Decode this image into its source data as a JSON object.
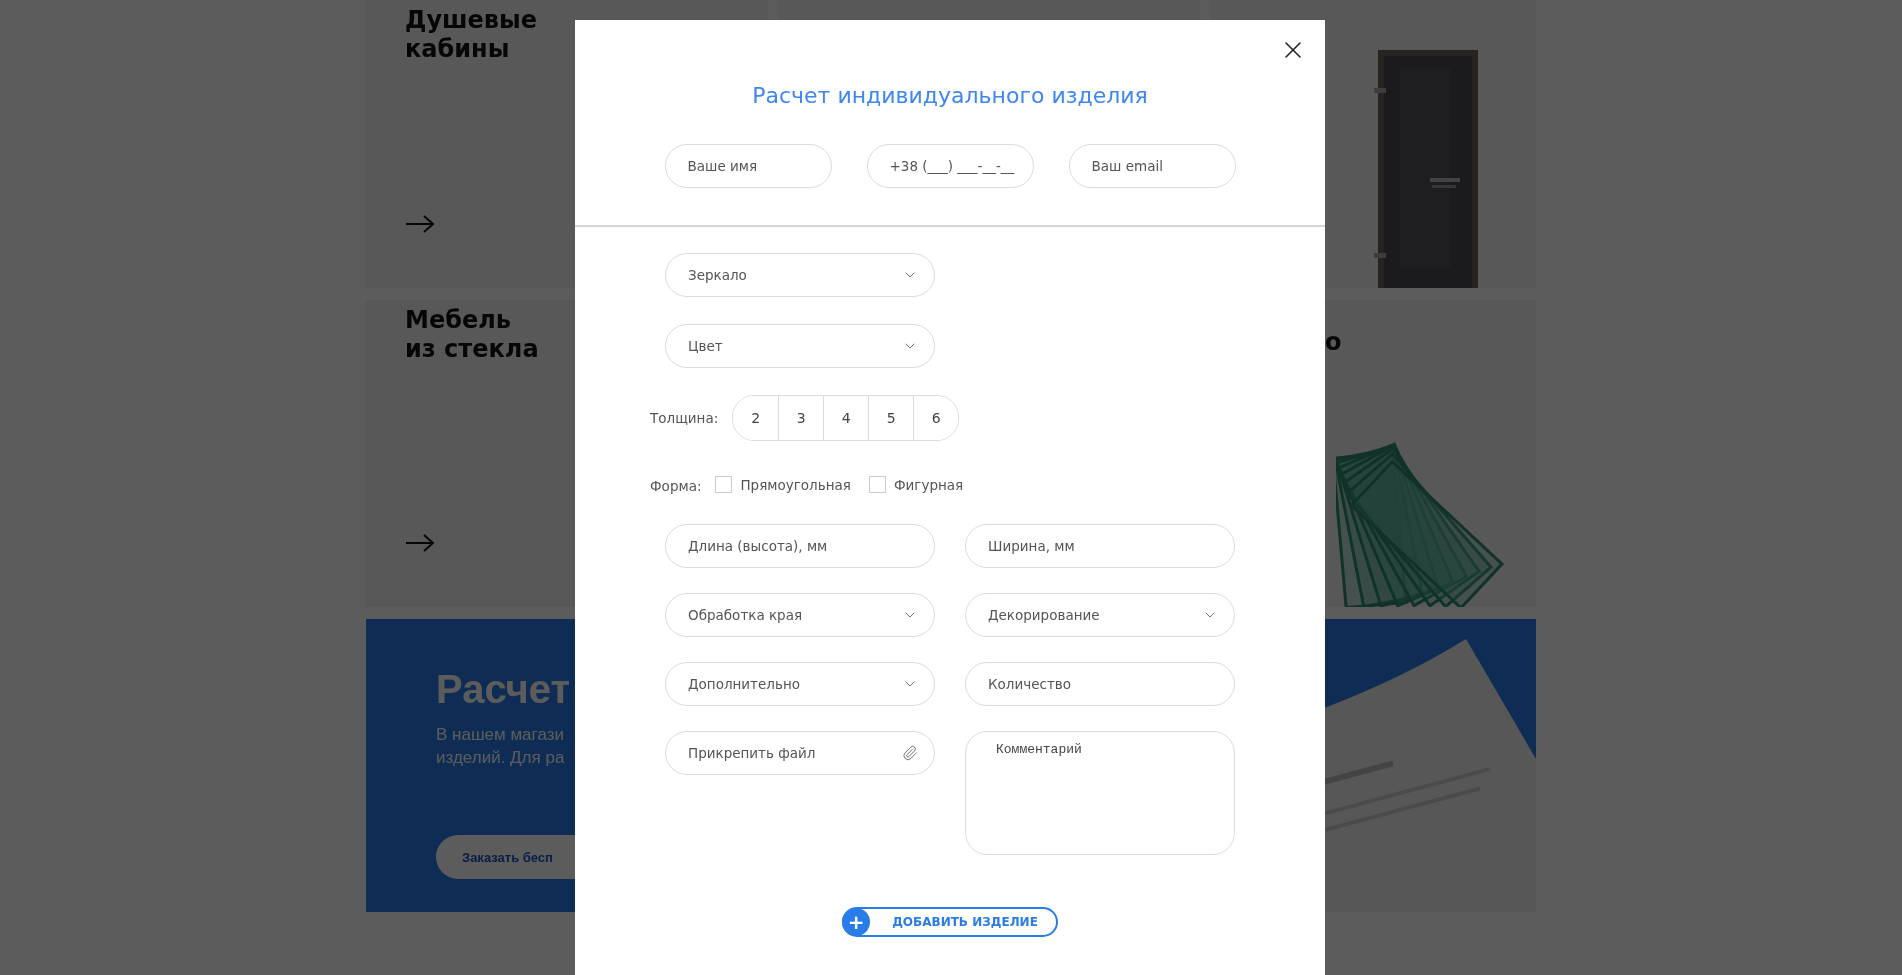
{
  "background": {
    "card_rows": [
      [
        {
          "title": "Душевые\nкабины",
          "kind": "arrow"
        },
        {
          "kind": "plain"
        },
        {
          "kind": "door"
        }
      ],
      [
        {
          "title": "Мебель\nиз стекла",
          "kind": "arrow"
        },
        null,
        {
          "title": "о",
          "kind": "glass"
        }
      ]
    ],
    "banner": {
      "title": "Расчет",
      "text": "В нашем магази\nизделий. Для ра",
      "button": "Заказать бесп"
    }
  },
  "modal": {
    "title": "Расчет индивидуального изделия",
    "contacts": [
      {
        "placeholder": "Ваше имя"
      },
      {
        "placeholder": "+38 (___) ___-__-__"
      },
      {
        "placeholder": "Ваш email"
      }
    ],
    "selects": [
      {
        "value": "Зеркало"
      },
      {
        "value": "Цвет"
      }
    ],
    "thickness": {
      "label": "Толщина:",
      "options": [
        {
          "label": "2",
          "selected": false
        },
        {
          "label": "3",
          "selected": false
        },
        {
          "label": "4",
          "selected": false
        },
        {
          "label": "5",
          "selected": false
        },
        {
          "label": "6",
          "selected": false
        }
      ]
    },
    "shape": {
      "label": "Форма:",
      "options": [
        {
          "label": "Прямоугольная",
          "checked": false
        },
        {
          "label": "Фигурная",
          "checked": false
        }
      ]
    },
    "fields": [
      {
        "kind": "input",
        "placeholder": "Длина (высота), мм"
      },
      {
        "kind": "input",
        "placeholder": "Ширина, мм"
      },
      {
        "kind": "select",
        "placeholder": "Обработка края"
      },
      {
        "kind": "select",
        "placeholder": "Декорирование"
      },
      {
        "kind": "select",
        "placeholder": "Дополнительно"
      },
      {
        "kind": "input",
        "placeholder": "Количество"
      },
      {
        "kind": "file",
        "placeholder": "Прикрепить файл"
      },
      {
        "kind": "textarea",
        "placeholder": "Комментарий"
      }
    ],
    "add_button": {
      "icon": "+",
      "label": "ДОБАВИТЬ ИЗДЕЛИЕ"
    }
  }
}
